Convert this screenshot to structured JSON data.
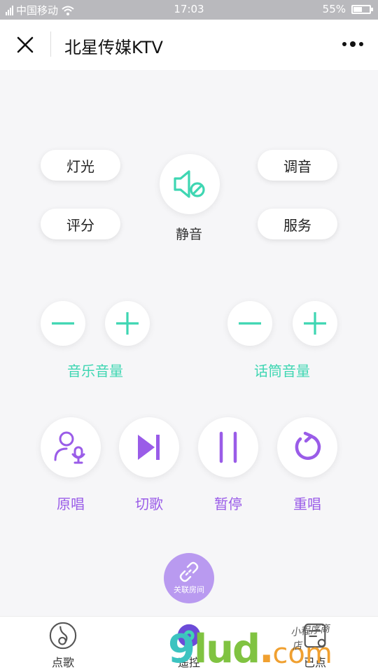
{
  "status_bar": {
    "carrier": "中国移动",
    "time": "17:03",
    "battery_percent": "55%",
    "battery_level": 0.55
  },
  "header": {
    "title": "北星传媒KTV"
  },
  "controls": {
    "lights": "灯光",
    "tuning": "调音",
    "score": "评分",
    "service": "服务",
    "mute": "静音"
  },
  "volume": {
    "music_label": "音乐音量",
    "mic_label": "话筒音量"
  },
  "playback": {
    "original": "原唱",
    "next": "切歌",
    "pause": "暂停",
    "replay": "重唱"
  },
  "link_room": {
    "label": "关联房间"
  },
  "tabs": [
    {
      "label": "点歌",
      "icon": "music-note-icon"
    },
    {
      "label": "遥控",
      "icon": "remote-icon"
    },
    {
      "label": "已点",
      "icon": "list-icon"
    }
  ],
  "watermark": {
    "main_9": "9",
    "main_lud": "lud",
    "dot": ".",
    "com": "com",
    "script": "小程序商店"
  },
  "colors": {
    "teal": "#3ed6b2",
    "purple": "#9a5ce8",
    "link_room_bg": "#b99af0"
  }
}
